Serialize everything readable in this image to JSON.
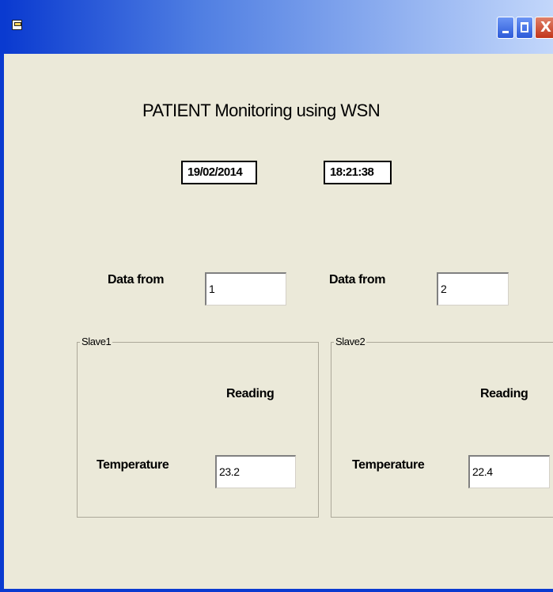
{
  "window": {
    "title": "",
    "controls": {
      "minimize_icon": "minimize-icon",
      "maximize_icon": "maximize-icon",
      "close_label": "X"
    }
  },
  "header": {
    "title": "PATIENT Monitoring using WSN",
    "date": "19/02/2014",
    "time": "18:21:38"
  },
  "data_from": [
    {
      "label": "Data from",
      "value": "1"
    },
    {
      "label": "Data from",
      "value": "2"
    }
  ],
  "slaves": [
    {
      "legend": "Slave1",
      "reading_label": "Reading",
      "temperature_label": "Temperature",
      "temperature_value": "23.2"
    },
    {
      "legend": "Slave2",
      "reading_label": "Reading",
      "temperature_label": "Temperature",
      "temperature_value": "22.4"
    }
  ],
  "colors": {
    "titlebar": "#0a3ad0",
    "background": "#ebe9d9",
    "close": "#c2351a"
  }
}
